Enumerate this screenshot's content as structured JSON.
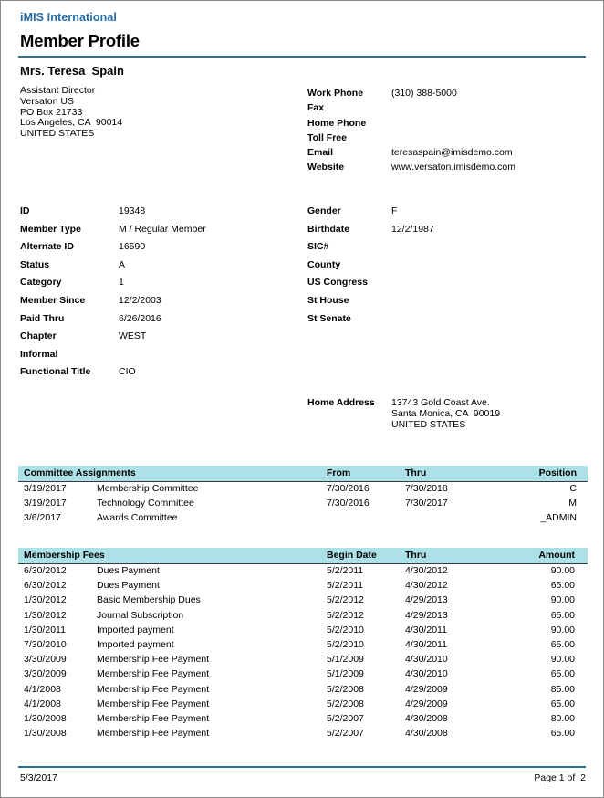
{
  "header": {
    "brand": "iMIS International",
    "title": "Member Profile",
    "accent_color": "#1f6ba8",
    "rule_color": "#2e6f96"
  },
  "member": {
    "name": "Mrs. Teresa  Spain",
    "address_lines": [
      "Assistant Director",
      "Versaton US",
      "PO Box 21733",
      "Los Angeles, CA  90014",
      "UNITED STATES"
    ]
  },
  "contact": [
    {
      "label": "Work Phone",
      "value": "(310) 388-5000"
    },
    {
      "label": "Fax",
      "value": ""
    },
    {
      "label": "Home Phone",
      "value": ""
    },
    {
      "label": "Toll Free",
      "value": ""
    },
    {
      "label": "Email",
      "value": "teresaspain@imisdemo.com"
    },
    {
      "label": "Website",
      "value": "www.versaton.imisdemo.com"
    }
  ],
  "fields_left": [
    {
      "label": "ID",
      "value": "19348"
    },
    {
      "label": "Member Type",
      "value": "M / Regular Member"
    },
    {
      "label": "Alternate ID",
      "value": "16590"
    },
    {
      "label": "Status",
      "value": "A"
    },
    {
      "label": "Category",
      "value": "1"
    },
    {
      "label": "Member Since",
      "value": "12/2/2003"
    },
    {
      "label": "Paid Thru",
      "value": "6/26/2016"
    },
    {
      "label": "Chapter",
      "value": "WEST"
    },
    {
      "label": "Informal",
      "value": ""
    },
    {
      "label": "Functional Title",
      "value": "CIO"
    }
  ],
  "fields_right": [
    {
      "label": "Gender",
      "value": "F"
    },
    {
      "label": "Birthdate",
      "value": "12/2/1987"
    },
    {
      "label": "SIC#",
      "value": ""
    },
    {
      "label": "County",
      "value": ""
    },
    {
      "label": "US Congress",
      "value": ""
    },
    {
      "label": "St House",
      "value": ""
    },
    {
      "label": "St Senate",
      "value": ""
    }
  ],
  "home_address": {
    "label": "Home Address",
    "lines": [
      "13743 Gold Coast Ave.",
      "Santa Monica, CA  90019",
      "UNITED STATES"
    ]
  },
  "committee_table": {
    "header_bg": "#ade1e8",
    "columns": [
      "Committee Assignments",
      "From",
      "Thru",
      "Position"
    ],
    "rows": [
      {
        "date": "3/19/2017",
        "name": "Membership Committee",
        "from": "7/30/2016",
        "thru": "7/30/2018",
        "position": "C"
      },
      {
        "date": "3/19/2017",
        "name": "Technology Committee",
        "from": "7/30/2016",
        "thru": "7/30/2017",
        "position": "M"
      },
      {
        "date": "3/6/2017",
        "name": "Awards Committee",
        "from": "",
        "thru": "",
        "position": "_ADMIN"
      }
    ]
  },
  "fees_table": {
    "header_bg": "#ade1e8",
    "columns": [
      "Membership Fees",
      "Begin Date",
      "Thru",
      "Amount"
    ],
    "rows": [
      {
        "date": "6/30/2012",
        "name": "Dues Payment",
        "begin": "5/2/2011",
        "thru": "4/30/2012",
        "amount": "90.00"
      },
      {
        "date": "6/30/2012",
        "name": "Dues Payment",
        "begin": "5/2/2011",
        "thru": "4/30/2012",
        "amount": "65.00"
      },
      {
        "date": "1/30/2012",
        "name": "Basic Membership Dues",
        "begin": "5/2/2012",
        "thru": "4/29/2013",
        "amount": "90.00"
      },
      {
        "date": "1/30/2012",
        "name": "Journal Subscription",
        "begin": "5/2/2012",
        "thru": "4/29/2013",
        "amount": "65.00"
      },
      {
        "date": "1/30/2011",
        "name": "Imported payment",
        "begin": "5/2/2010",
        "thru": "4/30/2011",
        "amount": "90.00"
      },
      {
        "date": "7/30/2010",
        "name": "Imported payment",
        "begin": "5/2/2010",
        "thru": "4/30/2011",
        "amount": "65.00"
      },
      {
        "date": "3/30/2009",
        "name": "Membership Fee Payment",
        "begin": "5/1/2009",
        "thru": "4/30/2010",
        "amount": "90.00"
      },
      {
        "date": "3/30/2009",
        "name": "Membership Fee Payment",
        "begin": "5/1/2009",
        "thru": "4/30/2010",
        "amount": "65.00"
      },
      {
        "date": "4/1/2008",
        "name": "Membership Fee Payment",
        "begin": "5/2/2008",
        "thru": "4/29/2009",
        "amount": "85.00"
      },
      {
        "date": "4/1/2008",
        "name": "Membership Fee Payment",
        "begin": "5/2/2008",
        "thru": "4/29/2009",
        "amount": "65.00"
      },
      {
        "date": "1/30/2008",
        "name": "Membership Fee Payment",
        "begin": "5/2/2007",
        "thru": "4/30/2008",
        "amount": "80.00"
      },
      {
        "date": "1/30/2008",
        "name": "Membership Fee Payment",
        "begin": "5/2/2007",
        "thru": "4/30/2008",
        "amount": "65.00"
      }
    ]
  },
  "footer": {
    "date": "5/3/2017",
    "page": "Page 1 of  2"
  }
}
